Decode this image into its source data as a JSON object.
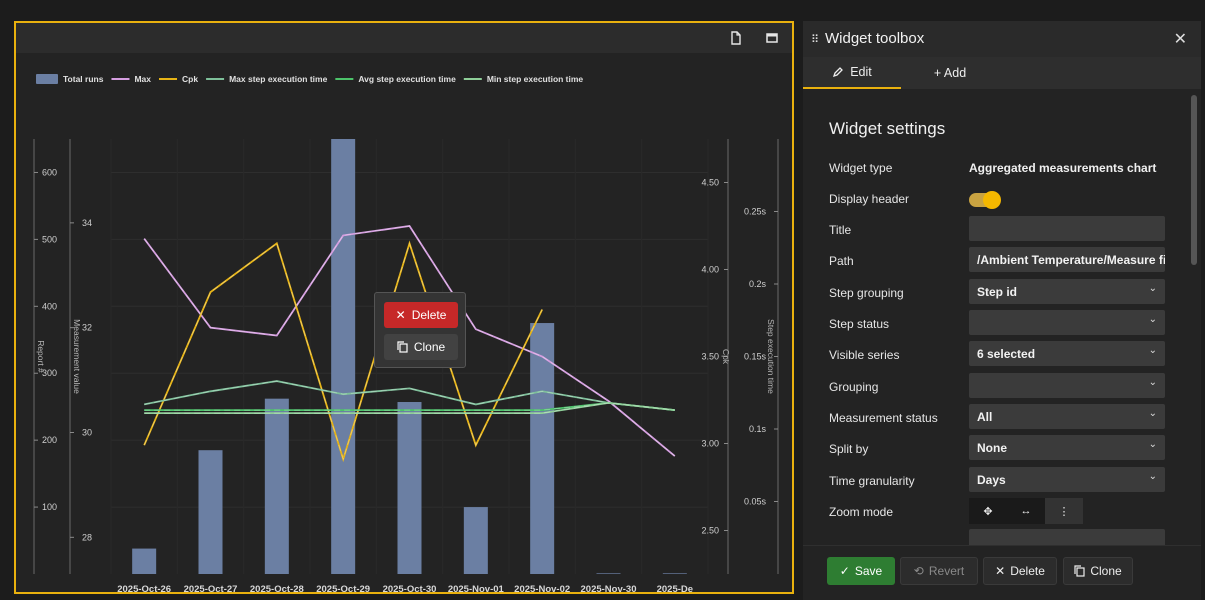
{
  "chart_data": {
    "type": "bar",
    "categories": [
      "2025-Oct-26",
      "2025-Oct-27",
      "2025-Oct-28",
      "2025-Oct-29",
      "2025-Oct-30",
      "2025-Nov-01",
      "2025-Nov-02",
      "2025-Nov-30",
      "2025-De"
    ],
    "legend_position": "top-left",
    "grid": true,
    "series": [
      {
        "name": "Total runs",
        "type": "bar",
        "axis": "Report #",
        "color": "#6b7fa3",
        "values": [
          38,
          185,
          262,
          650,
          257,
          100,
          375,
          1,
          1
        ]
      },
      {
        "name": "Max",
        "type": "line",
        "axis": "Measurement value",
        "color": "#d59ee0",
        "values": [
          33.7,
          32.0,
          31.85,
          33.76,
          33.94,
          31.97,
          31.45,
          30.6,
          29.55
        ]
      },
      {
        "name": "Cpk",
        "type": "line",
        "axis": "Cpk",
        "color": "#e7b416",
        "values": [
          2.99,
          3.87,
          4.15,
          2.91,
          4.15,
          2.99,
          3.77,
          null,
          null
        ]
      },
      {
        "name": "Max step execution time",
        "type": "line",
        "axis": "Step execution time",
        "color": "#7ec09a",
        "values": [
          0.117,
          0.126,
          0.133,
          0.124,
          0.128,
          0.117,
          0.126,
          0.118,
          0.113
        ]
      },
      {
        "name": "Avg step execution time",
        "type": "line",
        "axis": "Step execution time",
        "color": "#4cc36a",
        "values": [
          0.113,
          0.113,
          0.113,
          0.113,
          0.113,
          0.113,
          0.113,
          0.118,
          0.113
        ]
      },
      {
        "name": "Min step execution time",
        "type": "line",
        "axis": "Step execution time",
        "color": "#8fcf99",
        "values": [
          0.111,
          0.111,
          0.111,
          0.111,
          0.111,
          0.111,
          0.111,
          0.118,
          0.113
        ]
      }
    ],
    "axes": {
      "report": {
        "title": "Report #",
        "ticks": [
          "100",
          "200",
          "300",
          "400",
          "500",
          "600"
        ],
        "range": [
          0,
          650
        ]
      },
      "measurement": {
        "title": "Measurement value",
        "ticks": [
          "28",
          "30",
          "32",
          "34"
        ],
        "range": [
          27.3,
          35.6
        ]
      },
      "cpk": {
        "title": "Cpk",
        "ticks": [
          "2.50",
          "3.00",
          "3.50",
          "4.00",
          "4.50"
        ],
        "range": [
          2.25,
          4.75
        ]
      },
      "step_time": {
        "title": "Step execution time",
        "ticks": [
          "0.05s",
          "0.1s",
          "0.15s",
          "0.2s",
          "0.25s"
        ],
        "range": [
          0,
          0.3
        ]
      }
    }
  },
  "context_menu": {
    "delete_label": "Delete",
    "clone_label": "Clone"
  },
  "toolbox": {
    "title": "Widget toolbox",
    "tabs": {
      "edit": "Edit",
      "add": "+ Add"
    },
    "settings_title": "Widget settings",
    "rows": {
      "widget_type": {
        "label": "Widget type",
        "value": "Aggregated measurements chart"
      },
      "display_header": {
        "label": "Display header",
        "checked": true
      },
      "title": {
        "label": "Title",
        "value": ""
      },
      "path": {
        "label": "Path",
        "value": "/Ambient Temperature/Measure fi:"
      },
      "step_grouping": {
        "label": "Step grouping",
        "value": "Step id"
      },
      "step_status": {
        "label": "Step status",
        "value": ""
      },
      "visible_series": {
        "label": "Visible series",
        "value": "6 selected"
      },
      "grouping": {
        "label": "Grouping",
        "value": ""
      },
      "measurement_status": {
        "label": "Measurement status",
        "value": "All"
      },
      "split_by": {
        "label": "Split by",
        "value": "None"
      },
      "time_granularity": {
        "label": "Time granularity",
        "value": "Days"
      },
      "zoom_mode": {
        "label": "Zoom mode"
      }
    },
    "footer": {
      "save": "Save",
      "revert": "Revert",
      "delete": "Delete",
      "clone": "Clone"
    }
  },
  "colors": {
    "accent": "#e9b10e",
    "save": "#2e7d32",
    "delete": "#c62828"
  }
}
